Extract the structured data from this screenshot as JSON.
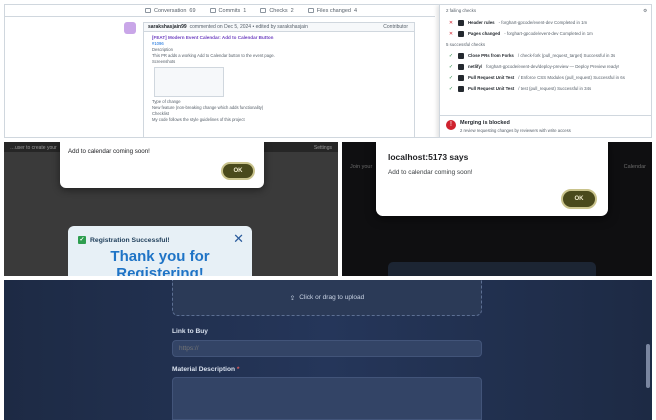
{
  "github": {
    "tabs": [
      {
        "label": "Conversation",
        "count": "69"
      },
      {
        "label": "Commits",
        "count": "1"
      },
      {
        "label": "Checks",
        "count": "2"
      },
      {
        "label": "Files changed",
        "count": "4"
      }
    ],
    "comment": {
      "author": "sarakshasjain99",
      "action": "commented on Dec 5, 2024 • edited by sarakshasjain",
      "menu": "Contributor",
      "title": "[FEAT] Modern Event Calendar: Add to Calendar Button",
      "link": "#1096",
      "lines": [
        "Description",
        "This PR adds a working Add to Calendar button to the event page.",
        "Screenshots",
        "Type of change",
        "New feature (non-breaking change which adds functionality)",
        "Checklist",
        "My code follows the style guidelines of this project"
      ]
    },
    "checks_panel": {
      "failing_header": "2 failing checks",
      "failing": [
        {
          "name": "Header rules",
          "desc": "- forghart-gpcode/event-dev  Completed in 1m"
        },
        {
          "name": "Pages changed",
          "desc": "- forghart-gpcode/event-dev  Completed in 1m"
        }
      ],
      "success_header": "5 successful checks",
      "success": [
        {
          "name": "Close PRs from Forks",
          "desc": "/ check-fork (pull_request_target)  Successful in 3s"
        },
        {
          "name": "netlify/",
          "desc": "forghart-gpcode/event-dev/deploy-preview — Deploy Preview ready!"
        },
        {
          "name": "Pull Request Unit Test",
          "desc": "/ Enforce CSS Modules (pull_request)  Successful in 6s"
        },
        {
          "name": "Pull Request Unit Test",
          "desc": "/ test (pull_request)  Successful in 34s"
        }
      ],
      "blocked_title": "Merging is blocked",
      "blocked_desc": "2 review requesting changes by reviewers with write access"
    }
  },
  "dialog_left": {
    "header_left": "…user to create your",
    "header_right": "Settings",
    "message": "Add to calendar coming soon!",
    "ok": "OK",
    "card_title": "Registration Successful!",
    "card_big": "Thank you for Registering!"
  },
  "dialog_right": {
    "header_left": "Join your",
    "header_right": "Calendar",
    "host": "localhost:5173 says",
    "message": "Add to calendar coming soon!",
    "ok": "OK"
  },
  "form": {
    "upload_text": "Click or drag to upload",
    "link_label": "Link to Buy",
    "link_placeholder": "https://",
    "desc_label": "Material Description",
    "required_mark": "*"
  },
  "colors": {
    "ok_button_bg": "#4a4a1c",
    "ok_button_border": "#c9c38c",
    "fail": "#cf222e",
    "success": "#1a7f37",
    "form_bg": "#1d2a44"
  }
}
